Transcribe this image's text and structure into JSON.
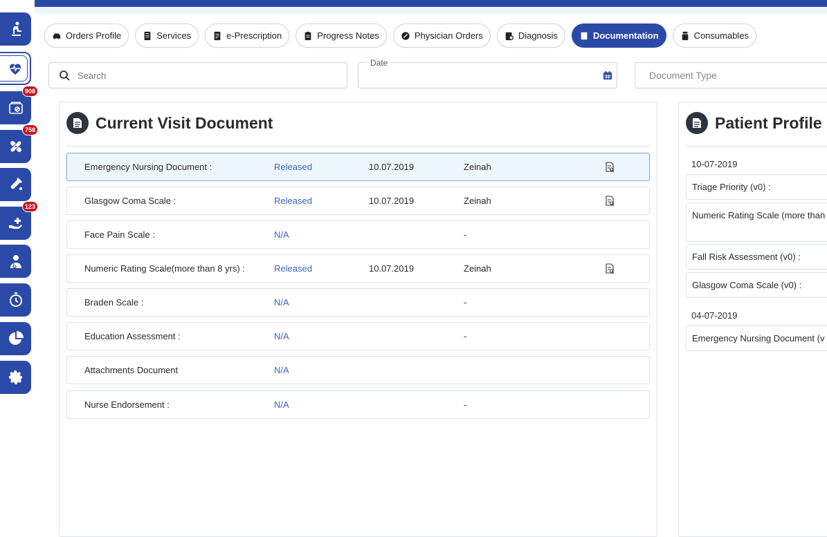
{
  "sidebar": {
    "items": [
      {
        "icon": "patient-bed-icon",
        "badge": ""
      },
      {
        "icon": "heart-pulse-icon",
        "badge": "",
        "active": true
      },
      {
        "icon": "prescription-folder-icon",
        "badge": "908"
      },
      {
        "icon": "bandage-icon",
        "badge": "758"
      },
      {
        "icon": "test-tube-icon",
        "badge": ""
      },
      {
        "icon": "hand-care-icon",
        "badge": "123"
      },
      {
        "icon": "doctor-icon",
        "badge": ""
      },
      {
        "icon": "stopwatch-icon",
        "badge": ""
      },
      {
        "icon": "pie-chart-icon",
        "badge": ""
      },
      {
        "icon": "gear-icon",
        "badge": ""
      }
    ]
  },
  "tabs": [
    {
      "label": "Orders Profile",
      "icon": "taxi-icon"
    },
    {
      "label": "Services",
      "icon": "list-icon"
    },
    {
      "label": "e-Prescription",
      "icon": "document-icon"
    },
    {
      "label": "Progress Notes",
      "icon": "clipboard-icon"
    },
    {
      "label": "Physician Orders",
      "icon": "pill-icon"
    },
    {
      "label": "Diagnosis",
      "icon": "diagnosis-icon"
    },
    {
      "label": "Documentation",
      "icon": "book-icon",
      "active": true
    },
    {
      "label": "Consumables",
      "icon": "jar-icon"
    }
  ],
  "filters": {
    "search_placeholder": "Search",
    "date_label": "Date",
    "date_value": "",
    "doctype_placeholder": "Document Type"
  },
  "current_visit": {
    "title": "Current Visit Document",
    "rows": [
      {
        "name": "Emergency Nursing Document :",
        "status": "Released",
        "date": "10.07.2019",
        "user": "Zeinah",
        "has_action": true
      },
      {
        "name": "Glasgow Coma Scale :",
        "status": "Released",
        "date": "10.07.2019",
        "user": "Zeinah",
        "has_action": true
      },
      {
        "name": "Face Pain Scale :",
        "status": "N/A",
        "date": "",
        "user": "-",
        "has_action": false
      },
      {
        "name": "Numeric Rating Scale(more than 8 yrs) :",
        "status": "Released",
        "date": "10.07.2019",
        "user": "Zeinah",
        "has_action": true
      },
      {
        "name": "Braden Scale :",
        "status": "N/A",
        "date": "",
        "user": "-",
        "has_action": false
      },
      {
        "name": "Education Assessment :",
        "status": "N/A",
        "date": "",
        "user": "-",
        "has_action": false
      },
      {
        "name": "Attachments Document",
        "status": "N/A",
        "date": "",
        "user": "",
        "has_action": false
      },
      {
        "name": "Nurse Endorsement :",
        "status": "N/A",
        "date": "",
        "user": "-",
        "has_action": false
      }
    ]
  },
  "patient_profile": {
    "title": "Patient Profile D",
    "groups": [
      {
        "date": "10-07-2019",
        "items": [
          "Triage Priority (v0) :",
          "Numeric Rating Scale (more than :",
          "Fall Risk Assessment (v0) :",
          "Glasgow Coma Scale (v0) :"
        ]
      },
      {
        "date": "04-07-2019",
        "items": [
          "Emergency Nursing Document (v"
        ]
      }
    ]
  },
  "colors": {
    "primary": "#2b4aa8",
    "badge": "#c2161f",
    "status_link": "#3b63c4"
  }
}
